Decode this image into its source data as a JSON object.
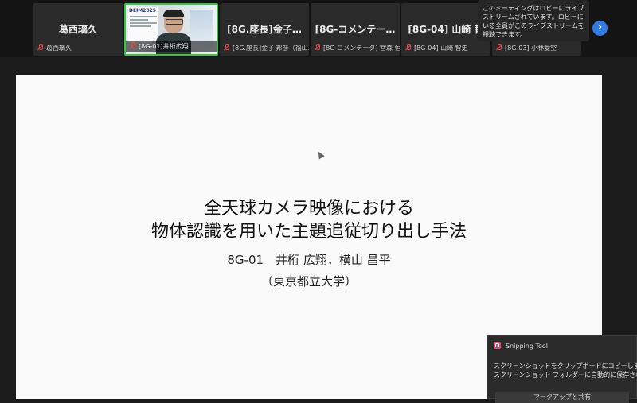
{
  "participants": [
    {
      "name": "葛西璃久",
      "caption": "葛西璃久",
      "muted": true
    },
    {
      "name": "",
      "caption": "[8G-01]井桁広翔",
      "muted": true,
      "video": true,
      "poster_logo": "DEIM2025"
    },
    {
      "name": "[8G.座長]金子…",
      "caption": "[8G.座長]金子 邦彦（福山…",
      "muted": true
    },
    {
      "name": "[8G-コメンテー…",
      "caption": "[8G-コメンテータ] 宮森 恒",
      "muted": true
    },
    {
      "name": "[8G-04] 山崎 晢",
      "caption": "[8G-04] 山崎 智史",
      "muted": true
    },
    {
      "name": "",
      "caption": "[8G-03] 小林愛空",
      "muted": true
    }
  ],
  "lobby_notice": "このミーティングはロビーにライブストリームされています。ロビーにいる全員がこのライブストリームを視聴できます。",
  "next_icon": "chevron-right-icon",
  "slide": {
    "title_line1": "全天球カメラ映像における",
    "title_line2": "物体認識を用いた主題追従切り出し手法",
    "authors": "8G-01　井桁 広翔，横山 昌平",
    "affiliation": "（東京都立大学）"
  },
  "toast": {
    "app": "Snipping Tool",
    "line1": "スクリーンショットをクリップボードにコピーしました",
    "line2": "スクリーンショット フォルダーに自動的に保存されまし",
    "button": "マークアップと共有"
  }
}
